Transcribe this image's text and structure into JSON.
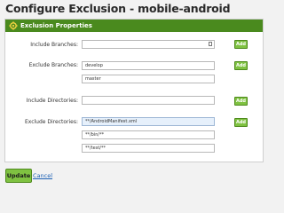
{
  "page": {
    "title": "Configure Exclusion - mobile-android"
  },
  "panel": {
    "header": "Exclusion Properties",
    "header_icon": "settings-gear-icon",
    "accent_color": "#4a8a1e"
  },
  "include_branches": {
    "label": "Include Branches:",
    "values": [
      ""
    ],
    "add_label": "Add"
  },
  "exclude_branches": {
    "label": "Exclude Branches:",
    "values": [
      "develop",
      "master"
    ],
    "add_label": "Add"
  },
  "include_directories": {
    "label": "Include Directories:",
    "values": [
      ""
    ],
    "add_label": "Add"
  },
  "exclude_directories": {
    "label": "Exclude Directories:",
    "values": [
      "**/AndroidManifest.xml",
      "**/bin/**",
      "**/test/**"
    ],
    "add_label": "Add"
  },
  "footer": {
    "update_label": "Update",
    "cancel_label": "Cancel"
  }
}
